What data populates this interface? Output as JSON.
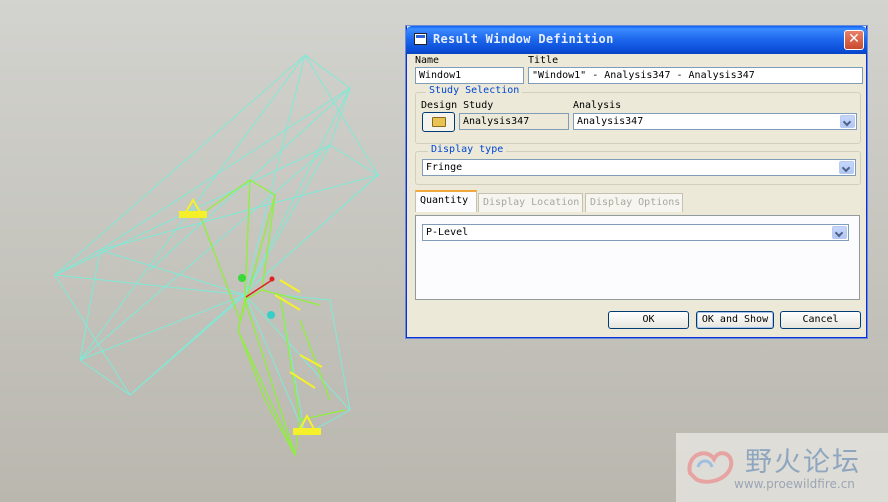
{
  "dialog": {
    "title": "Result Window Definition",
    "close_glyph": "✕",
    "name_label": "Name",
    "name_value": "Window1",
    "title_label": "Title",
    "title_value": "\"Window1\" - Analysis347 - Analysis347",
    "study_selection": {
      "group_label": "Study Selection",
      "design_study_label": "Design Study",
      "design_study_value": "Analysis347",
      "analysis_label": "Analysis",
      "analysis_value": "Analysis347"
    },
    "display_type": {
      "group_label": "Display type",
      "value": "Fringe"
    },
    "tabs": [
      {
        "label": "Quantity",
        "active": true
      },
      {
        "label": "Display Location",
        "active": false
      },
      {
        "label": "Display Options",
        "active": false
      }
    ],
    "quantity_value": "P-Level",
    "buttons": {
      "ok": "OK",
      "ok_and_show": "OK and Show",
      "cancel": "Cancel"
    }
  },
  "watermark": {
    "text": "野火论坛",
    "url": "www.proewildfire.cn"
  },
  "colors": {
    "model_wire": "#7fead6",
    "model_green": "#8ff03c",
    "constraint_yellow": "#f5f02a",
    "titlebar_blue": "#0b4fd8",
    "dialog_bg": "#ece9d8"
  },
  "icons": [
    "close-icon",
    "open-folder-icon",
    "chevron-down-icon",
    "app-icon"
  ]
}
